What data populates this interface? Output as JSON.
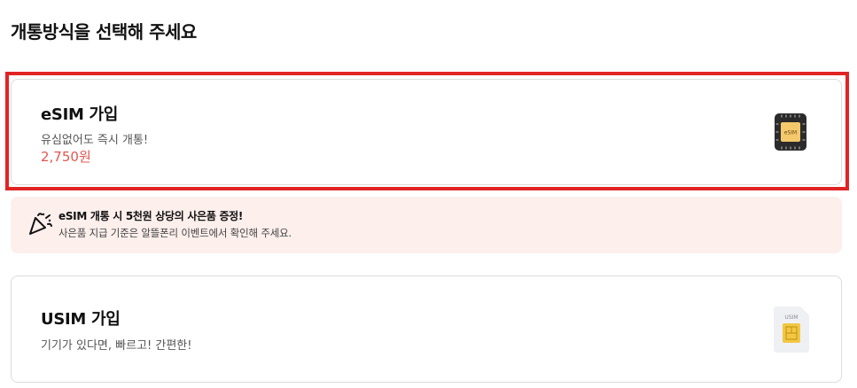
{
  "page": {
    "title": "개통방식을 선택해 주세요"
  },
  "esim": {
    "title": "eSIM 가입",
    "description": "유심없어도 즉시 개통!",
    "price": "2,750원",
    "icon_label": "eSIM",
    "icon": "esim-chip-icon",
    "selected": true
  },
  "promo": {
    "title": "eSIM 개통 시 5천원 상당의 사은품 증정!",
    "description": "사은품 지급 기준은 알뜰폰리 이벤트에서 확인해 주세요.",
    "icon": "party-popper-icon"
  },
  "usim": {
    "title": "USIM 가입",
    "description": "기기가 있다면, 빠르고! 간편한!",
    "icon_label": "USIM",
    "icon": "usim-card-icon"
  },
  "colors": {
    "selection_border": "#e02424",
    "price": "#e0574f",
    "promo_background": "#fcefec",
    "chip_gold": "#f5c96b",
    "esim_dark": "#2b2b2b"
  }
}
